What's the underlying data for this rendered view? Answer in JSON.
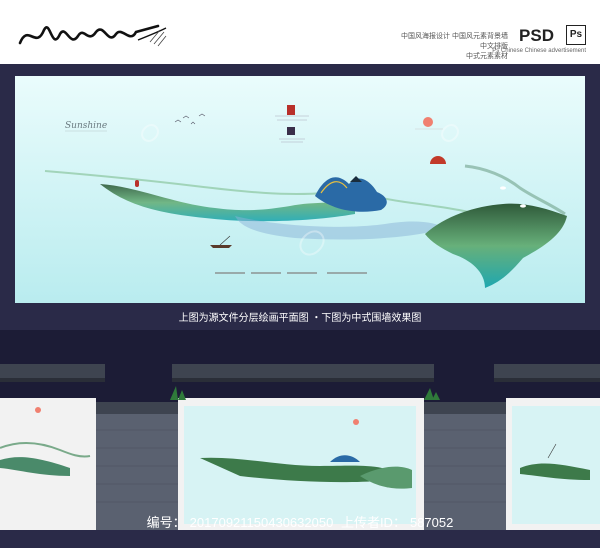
{
  "header": {
    "cn_lines": [
      "中国风海报设计 中国风元素背景墙",
      "中文排版",
      "中式元素素材"
    ],
    "psd_label": "PSD",
    "ps_label": "Ps",
    "psd_sub": "Ps Chinese Chinese advertisement"
  },
  "poster": {
    "script_title": "Sunshine"
  },
  "caption": "上图为源文件分层绘画平面图 ・下图为中式围墙效果图",
  "footer": {
    "id_label": "编号：",
    "id_value": "20170921150430632050",
    "uploader_label": "上传者ID：",
    "uploader_value": "587052"
  },
  "colors": {
    "page_bg": "#2a2a48",
    "poster_sky": "#c8eef1",
    "water": "#2fc2c4",
    "ink_green": "#3d7a4a",
    "wall_brick": "#5a6170",
    "roof": "#3e4450",
    "sun": "#f08070"
  }
}
